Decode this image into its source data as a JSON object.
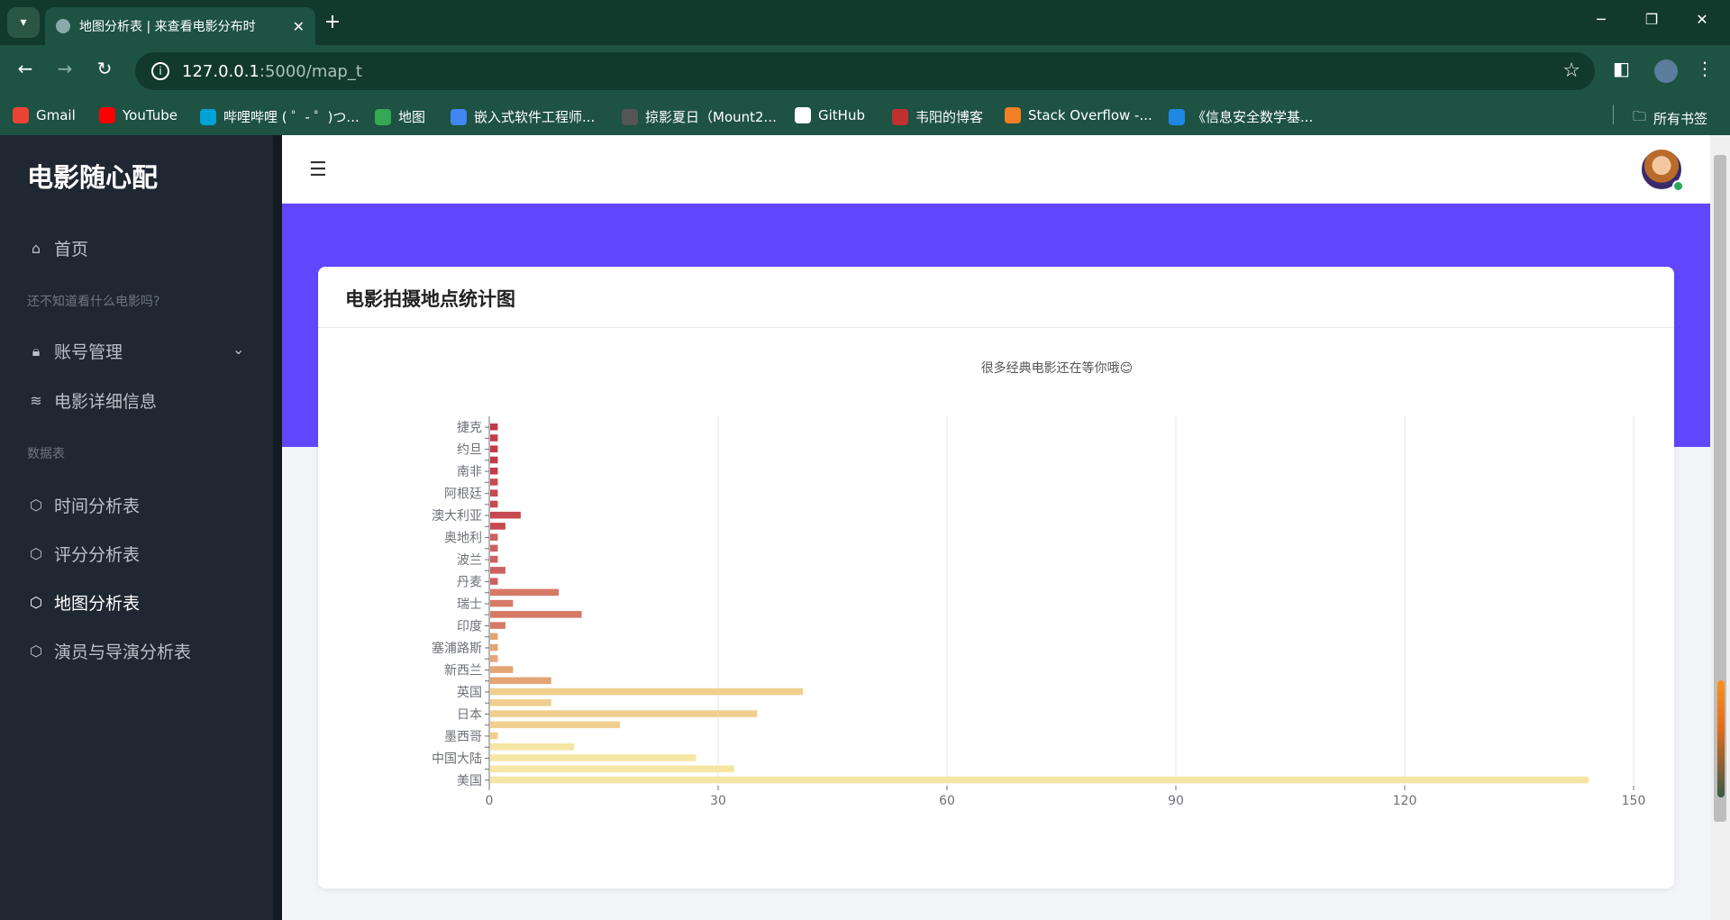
{
  "browser": {
    "tab_title": "地图分析表 | 来查看电影分布时",
    "url_host": "127.0.0.1",
    "url_rest": ":5000/map_t",
    "bookmarks": [
      {
        "label": "Gmail",
        "color": "#ea4335"
      },
      {
        "label": "YouTube",
        "color": "#ff0000"
      },
      {
        "label": "哔哩哔哩 ( ゜- ゜)つ...",
        "color": "#00a1d6"
      },
      {
        "label": "地图",
        "color": "#34a853"
      },
      {
        "label": "嵌入式软件工程师...",
        "color": "#4285f4"
      },
      {
        "label": "掠影夏日（Mount2...",
        "color": "#555555"
      },
      {
        "label": "GitHub",
        "color": "#ffffff"
      },
      {
        "label": "韦阳的博客",
        "color": "#c03030"
      },
      {
        "label": "Stack Overflow -...",
        "color": "#f48024"
      },
      {
        "label": "《信息安全数学基...",
        "color": "#1e88e5"
      }
    ],
    "all_bookmarks": "所有书签"
  },
  "sidebar": {
    "brand": "电影随心配",
    "home": "首页",
    "section1": "还不知道看什么电影吗?",
    "account": "账号管理",
    "movie_detail": "电影详细信息",
    "section2": "数据表",
    "time_table": "时间分析表",
    "score_table": "评分分析表",
    "map_table": "地图分析表",
    "actor_table": "演员与导演分析表"
  },
  "card": {
    "title": "电影拍摄地点统计图"
  },
  "chart_data": {
    "type": "bar",
    "orientation": "horizontal",
    "title": "很多经典电影还在等你哦😊",
    "categories": [
      "捷克",
      "",
      "约旦",
      "",
      "南非",
      "",
      "阿根廷",
      "",
      "澳大利亚",
      "",
      "奥地利",
      "",
      "波兰",
      "",
      "丹麦",
      "",
      "瑞士",
      "",
      "印度",
      "",
      "塞浦路斯",
      "",
      "新西兰",
      "",
      "英国",
      "",
      "日本",
      "",
      "墨西哥",
      "",
      "中国大陆",
      "",
      "美国"
    ],
    "values": [
      1,
      1,
      1,
      1,
      1,
      1,
      1,
      1,
      4,
      2,
      1,
      1,
      1,
      2,
      1,
      9,
      3,
      12,
      2,
      1,
      1,
      1,
      3,
      8,
      41,
      8,
      35,
      17,
      1,
      11,
      27,
      32,
      144
    ],
    "xlim": [
      0,
      150
    ],
    "xticks": [
      0,
      30,
      60,
      90,
      120,
      150
    ],
    "grid": true,
    "colors": [
      "#c23b4b",
      "#c64a50",
      "#cd6060",
      "#d67a66",
      "#e3a574",
      "#f0cf8e",
      "#f6e6a4"
    ]
  }
}
